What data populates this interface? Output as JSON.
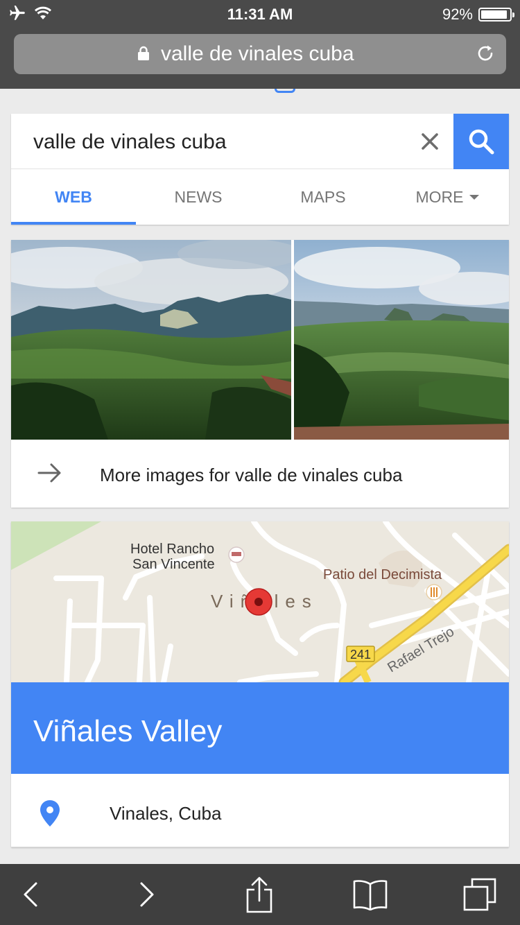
{
  "status_bar": {
    "time": "11:31 AM",
    "battery": "92%",
    "airplane_icon": "airplane-icon",
    "wifi_icon": "wifi-icon",
    "battery_level": 0.92
  },
  "browser": {
    "url": "valle de vinales cuba",
    "lock_icon": "lock-icon",
    "reload_icon": "reload-icon"
  },
  "search": {
    "query": "valle de vinales cuba",
    "clear_icon": "close-icon",
    "submit_icon": "search-icon"
  },
  "tabs": [
    {
      "label": "WEB",
      "active": true
    },
    {
      "label": "NEWS",
      "active": false
    },
    {
      "label": "MAPS",
      "active": false
    },
    {
      "label": "MORE",
      "active": false
    }
  ],
  "images": {
    "more_label": "More images for valle de vinales cuba",
    "arrow_icon": "arrow-right-icon"
  },
  "map": {
    "hotel_line1": "Hotel Rancho",
    "hotel_line2": "San Vincente",
    "restaurant": "Patio del Decimista",
    "town": "Viñales",
    "road_number": "241",
    "street": "Rafael Trejo"
  },
  "knowledge_panel": {
    "title": "Viñales Valley",
    "location": "Vinales, Cuba",
    "pin_icon": "location-pin-icon"
  },
  "toolbar": {
    "back_icon": "chevron-left-icon",
    "forward_icon": "chevron-right-icon",
    "share_icon": "share-icon",
    "bookmarks_icon": "book-icon",
    "tabs_icon": "tabs-icon"
  },
  "colors": {
    "accent": "#4285f4",
    "chrome": "#4a4a4a",
    "toolbar": "#3f3f3f",
    "road_yellow": "#f4d13d",
    "map_bg": "#ece8df",
    "pin_red": "#e53935"
  }
}
